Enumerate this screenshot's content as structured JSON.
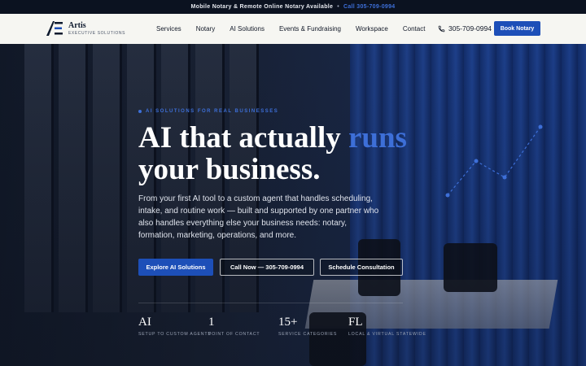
{
  "topbar": {
    "message": "Mobile Notary & Remote Online Notary Available",
    "separator": "•",
    "call": "Call 305-709-0994"
  },
  "brand": {
    "name": "Artis",
    "tagline": "EXECUTIVE SOLUTIONS"
  },
  "nav": {
    "items": [
      {
        "label": "Services"
      },
      {
        "label": "Notary"
      },
      {
        "label": "AI Solutions"
      },
      {
        "label": "Events & Fundraising"
      },
      {
        "label": "Workspace"
      },
      {
        "label": "Contact"
      }
    ],
    "phone": "305-709-0994",
    "cta": "Book Notary"
  },
  "hero": {
    "eyebrow": "AI SOLUTIONS FOR REAL BUSINESSES",
    "headline_part1": "AI that actually ",
    "headline_accent": "runs",
    "headline_part2": "your business.",
    "lead": "From your first AI tool to a custom agent that handles scheduling, intake, and routine work — built and supported by one partner who also handles everything else your business needs: notary, formation, marketing, operations, and more.",
    "buttons": {
      "primary": "Explore AI Solutions",
      "call": "Call Now — 305-709-0994",
      "schedule": "Schedule Consultation"
    },
    "stats": [
      {
        "value": "AI",
        "label": "SETUP TO CUSTOM AGENTS"
      },
      {
        "value": "1",
        "label": "POINT OF CONTACT"
      },
      {
        "value": "15+",
        "label": "SERVICE CATEGORIES"
      },
      {
        "value": "FL",
        "label": "LOCAL & VIRTUAL STATEWIDE"
      }
    ]
  },
  "colors": {
    "accent": "#1d4fb8",
    "accent_text": "#3d6fd8",
    "nav_bg": "#f6f6f2",
    "topbar_bg": "#0b1220"
  }
}
